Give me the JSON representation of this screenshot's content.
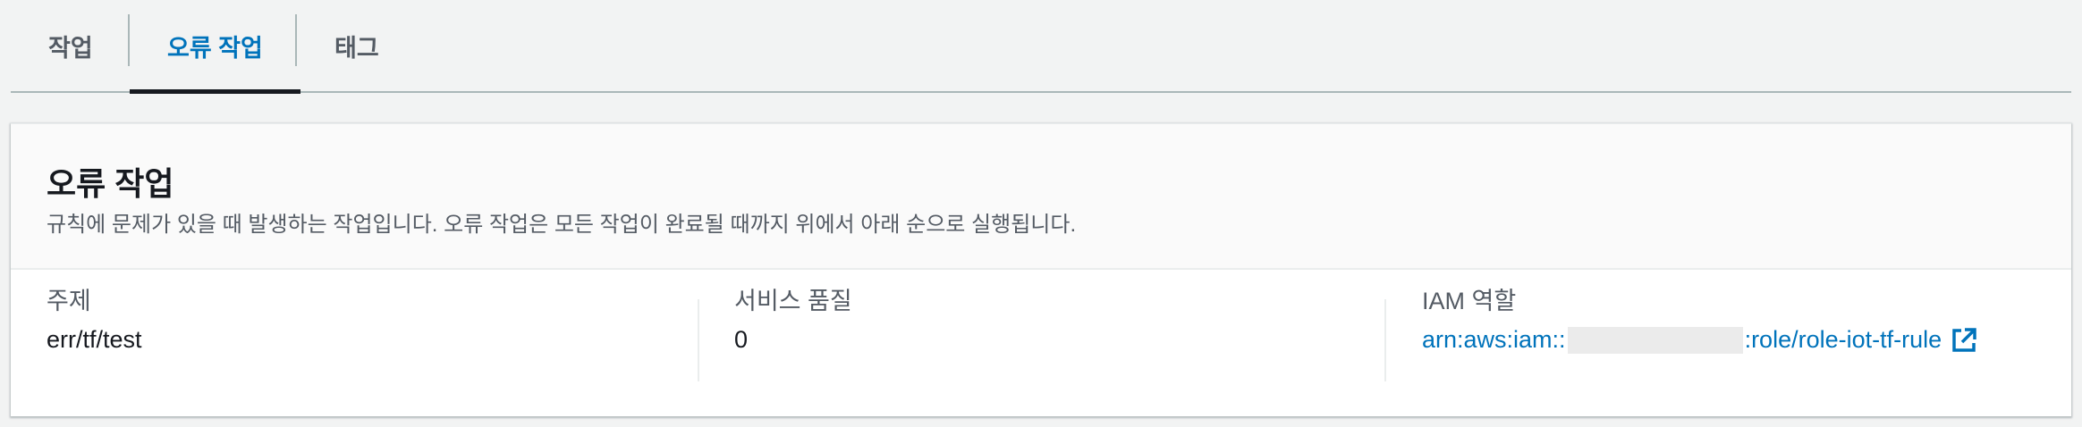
{
  "tabs": [
    {
      "label": "작업",
      "active": false
    },
    {
      "label": "오류 작업",
      "active": true
    },
    {
      "label": "태그",
      "active": false
    }
  ],
  "card": {
    "title": "오류 작업",
    "description": "규칙에 문제가 있을 때 발생하는 작업입니다. 오류 작업은 모든 작업이 완료될 때까지 위에서 아래 순으로 실행됩니다."
  },
  "details": {
    "topic": {
      "label": "주제",
      "value": "err/tf/test"
    },
    "qos": {
      "label": "서비스 품질",
      "value": "0"
    },
    "iam_role": {
      "label": "IAM 역할",
      "link_prefix": "arn:aws:iam::",
      "link_suffix": ":role/role-iot-tf-rule",
      "icon": "external-link-icon"
    }
  },
  "colors": {
    "link": "#0073bb",
    "text": "#16191f",
    "secondary_text": "#545b64",
    "background": "#f2f3f3"
  }
}
